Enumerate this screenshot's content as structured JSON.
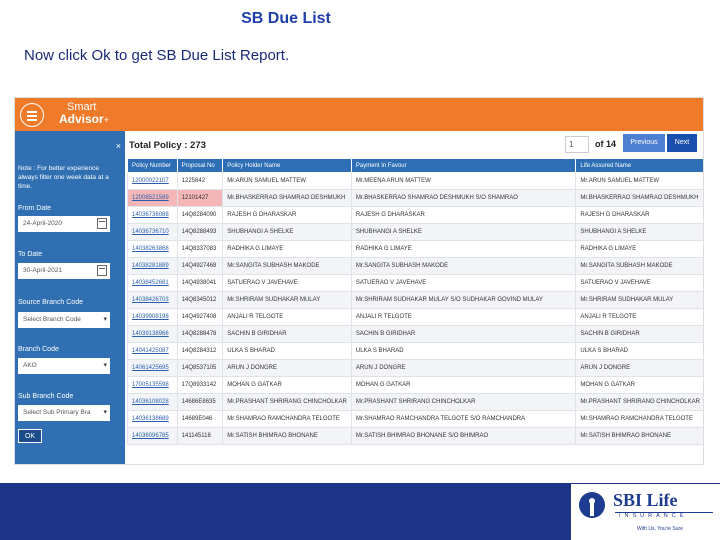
{
  "slide": {
    "title": "SB Due List",
    "instruction_prefix": "Now click Ok to get ",
    "instruction_bold": "SB Due List",
    "instruction_suffix": " Report."
  },
  "app": {
    "brand_line1": "Smart",
    "brand_line2": "Advisor",
    "brand_suffix": "+",
    "accent_color": "#ef7a2a",
    "sidebar_color": "#2f6fb2"
  },
  "sidebar": {
    "close": "×",
    "note": "Note : For better experience always filter one week data at a time.",
    "from_date_label": "From Date",
    "from_date_value": "24-April-2020",
    "to_date_label": "To Date",
    "to_date_value": "30-April-2021",
    "source_branch_label": "Source Branch Code",
    "source_branch_value": "Select Branch Code",
    "branch_code_label": "Branch Code",
    "branch_code_value": "AKO",
    "sub_branch_label": "Sub Branch Code",
    "sub_branch_value": "Select Sub Primary Bra",
    "ok_label": "OK"
  },
  "main": {
    "total_label": "Total Policy : 273",
    "page_value": "1",
    "page_of": "of 14",
    "prev_label": "Previous",
    "next_label": "Next"
  },
  "table": {
    "columns": [
      "Policy Number",
      "Proposal No",
      "Policy Holder Name",
      "Payment In Favour",
      "Life Assured Name"
    ],
    "rows": [
      [
        "12000022107",
        "1225842",
        "Mr.ARUN SAMUEL MATTEW",
        "Mr.MEENA ARUN MATTEW",
        "Mr.ARUN SAMUEL MATTEW"
      ],
      [
        "12008521589",
        "12101427",
        "Mr.BHASKERRAO SHAMRAO DESHMUKH",
        "Mr.BHASKERRAO SHAMRAO DESHMUKH S/O SHAMRAO",
        "Mr.BHASKERRAO SHAMRAO DESHMUKH"
      ],
      [
        "14036736088",
        "14Q8284090",
        "RAJESH G DHARASKAR",
        "RAJESH G DHARASKAR",
        "RAJESH G DHARASKAR"
      ],
      [
        "14036736710",
        "14Q8288493",
        "SHUBHANGI A SHELKE",
        "SHUBHANGI A SHELKE",
        "SHUBHANGI A SHELKE"
      ],
      [
        "14038263868",
        "14Q8337083",
        "RADHIKA G LIMAYE",
        "RADHIKA G LIMAYE",
        "RADHIKA G LIMAYE"
      ],
      [
        "14038281889",
        "14Q4927468",
        "Mr.SANGITA SUBHASH MAKODE",
        "Mr.SANGITA SUBHASH MAKODE",
        "Mr.SANGITA SUBHASH MAKODE"
      ],
      [
        "14038452681",
        "14Q4938041",
        "SATUERAO V JAVEHAVE",
        "SATUERAO V JAVEHAVE",
        "SATUERAO V JAVEHAVE"
      ],
      [
        "14038426703",
        "14Q8345012",
        "Mr.SHRIRAM SUDHAKAR MULAY",
        "Mr.SHRIRAM SUDHAKAR MULAY S/O SUDHAKAR GOVIND MULAY",
        "Mr.SHRIRAM SUDHAKAR MULAY"
      ],
      [
        "14039908198",
        "14Q4927408",
        "ANJALI R TELGOTE",
        "ANJALI R TELGOTE",
        "ANJALI R TELGOTE"
      ],
      [
        "14039138966",
        "14Q8288478",
        "SACHIN B GIRIDHAR",
        "SACHIN B GIRIDHAR",
        "SACHIN B GIRIDHAR"
      ],
      [
        "14041425087",
        "14Q8284312",
        "ULKA S BHARAD",
        "ULKA S BHARAD",
        "ULKA S BHARAD"
      ],
      [
        "14061425695",
        "14Q8537105",
        "ARUN J DONGRE",
        "ARUN J DONGRE",
        "ARUN J DONGRE"
      ],
      [
        "17005135598",
        "17Q8933142",
        "MOHAN G GATKAR",
        "MOHAN G GATKAR",
        "MOHAN G GATKAR"
      ],
      [
        "14036108028",
        "14686E8635",
        "Mr.PRASHANT SHRIRANG CHINCHOLKAR",
        "Mr.PRASHANT SHRIRANG CHINCHOLKAR",
        "Mr.PRASHANT SHRIRANG CHINCHOLKAR"
      ],
      [
        "14036138689",
        "14689E046",
        "Mr.SHAMRAO RAMCHANDRA TELGOTE",
        "Mr.SHAMRAO RAMCHANDRA TELGOTE S/O RAMCHANDRA",
        "Mr.SHAMRAO RAMCHANDRA TELGOTE"
      ],
      [
        "14036096785",
        "141145118",
        "Mr.SATISH BHIMRAO BHONANE",
        "Mr.SATISH BHIMRAO BHONANE S/O BHIMRAO",
        "Mr.SATISH BHIMRAO BHONANE"
      ]
    ]
  },
  "footer": {
    "logo_name": "SBI Life",
    "logo_sub": "INSURANCE",
    "logo_tag": "With Us, You're Sure"
  }
}
